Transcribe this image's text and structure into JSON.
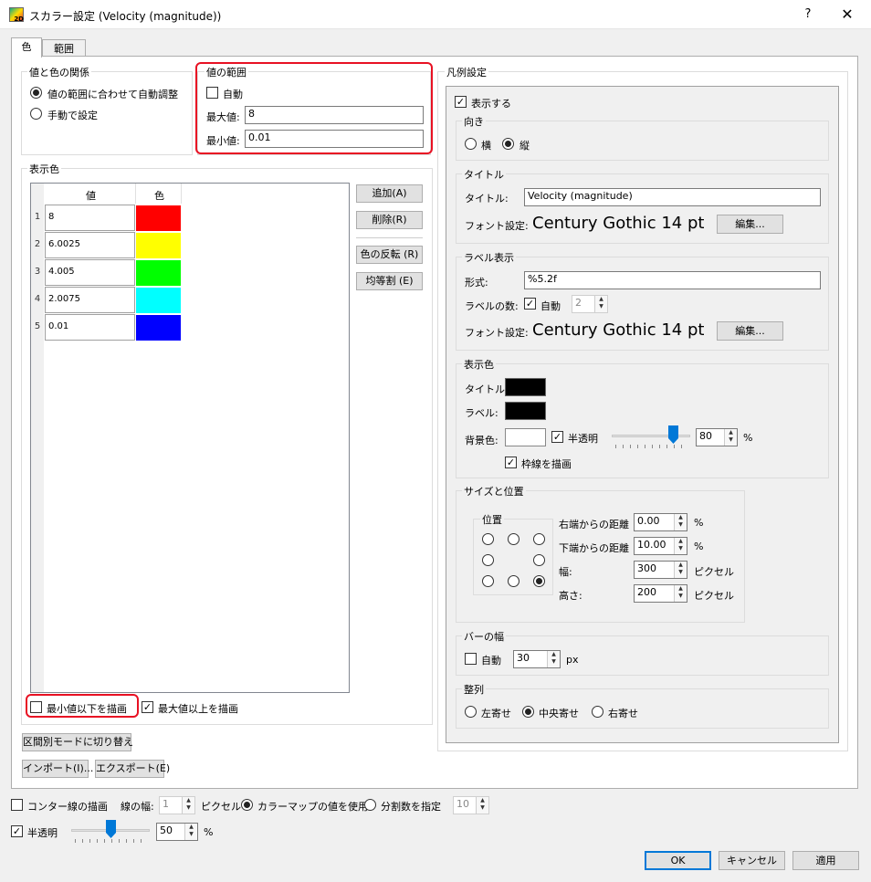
{
  "window": {
    "title": "スカラー設定 (Velocity (magnitude))",
    "help": "?",
    "close": "✕",
    "icon_text": "2D"
  },
  "tabs": [
    {
      "label": "色"
    },
    {
      "label": "範囲"
    }
  ],
  "relation": {
    "title": "値と色の関係",
    "auto_label": "値の範囲に合わせて自動調整",
    "manual_label": "手動で設定"
  },
  "range": {
    "title": "値の範囲",
    "auto_label": "自動",
    "max_label": "最大値:",
    "max_value": "8",
    "min_label": "最小値:",
    "min_value": "0.01"
  },
  "display_color": {
    "title": "表示色",
    "col_value": "値",
    "col_color": "色",
    "rows": [
      {
        "num": "1",
        "value": "8",
        "color": "#ff0000"
      },
      {
        "num": "2",
        "value": "6.0025",
        "color": "#ffff00"
      },
      {
        "num": "3",
        "value": "4.005",
        "color": "#00ff00"
      },
      {
        "num": "4",
        "value": "2.0075",
        "color": "#00ffff"
      },
      {
        "num": "5",
        "value": "0.01",
        "color": "#0000ff"
      }
    ],
    "add": "追加(A)",
    "delete": "削除(R)",
    "invert": "色の反転 (R)",
    "equal": "均等割 (E)",
    "below_min": "最小値以下を描画",
    "above_max": "最大値以上を描画"
  },
  "mode_switch": "区間別モードに切り替え",
  "import": "インポート(I)...",
  "export": "エクスポート(E)",
  "legend": {
    "title": "凡例設定",
    "show": "表示する",
    "orientation": {
      "title": "向き",
      "horizontal": "横",
      "vertical": "縦"
    },
    "title_group": {
      "title": "タイトル",
      "title_label": "タイトル:",
      "title_value": "Velocity (magnitude)",
      "font_label": "フォント設定:",
      "font_value": "Century Gothic 14 pt",
      "edit": "編集..."
    },
    "label_group": {
      "title": "ラベル表示",
      "format_label": "形式:",
      "format_value": "%5.2f",
      "count_label": "ラベルの数:",
      "count_auto": "自動",
      "count_value": "2",
      "font_label": "フォント設定:",
      "font_value": "Century Gothic 14 pt",
      "edit": "編集..."
    },
    "color_group": {
      "title": "表示色",
      "title_label": "タイトル:",
      "label_label": "ラベル:",
      "bg_label": "背景色:",
      "semi": "半透明",
      "opacity": "80",
      "percent": "%",
      "border": "枠線を描画",
      "title_color": "#000000",
      "label_color": "#000000",
      "bg_color": "#ffffff"
    },
    "size_group": {
      "title": "サイズと位置",
      "position": "位置",
      "right_label": "右端からの距離",
      "right_value": "0.00",
      "bottom_label": "下端からの距離",
      "bottom_value": "10.00",
      "width_label": "幅:",
      "width_value": "300",
      "height_label": "高さ:",
      "height_value": "200",
      "percent": "%",
      "pixel": "ピクセル"
    },
    "bar_group": {
      "title": "バーの幅",
      "auto": "自動",
      "value": "30",
      "unit": "px"
    },
    "align_group": {
      "title": "整列",
      "left": "左寄せ",
      "center": "中央寄せ",
      "right": "右寄せ"
    }
  },
  "bottom": {
    "contour": "コンター線の描画",
    "line_width_label": "線の幅:",
    "line_width": "1",
    "pixel": "ピクセル",
    "use_colormap": "カラーマップの値を使用",
    "divisions_label": "分割数を指定",
    "divisions": "10",
    "semi": "半透明",
    "semi_value": "50",
    "percent": "%"
  },
  "buttons": {
    "ok": "OK",
    "cancel": "キャンセル",
    "apply": "適用"
  }
}
